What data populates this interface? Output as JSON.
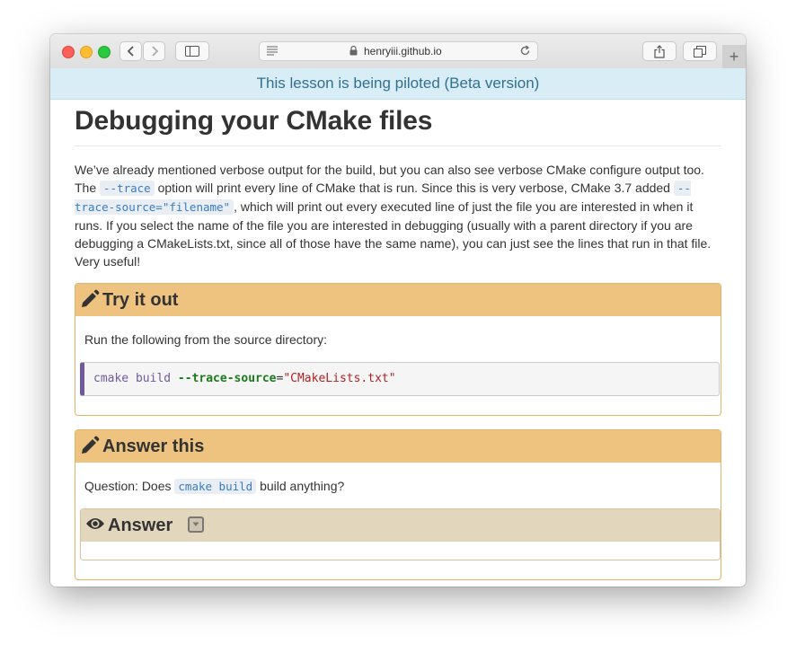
{
  "browser": {
    "url_domain": "henryiii.github.io",
    "new_tab_label": "+"
  },
  "banner": {
    "text": "This lesson is being piloted (Beta version)"
  },
  "page": {
    "title": "Debugging your CMake files",
    "intro": {
      "t1": "We’ve already mentioned verbose output for the build, but you can also see verbose CMake configure output too. The ",
      "code1": "--trace",
      "t2": " option will print every line of CMake that is run. Since this is very verbose, CMake 3.7 added ",
      "code2": "--trace-source=\"filename\"",
      "t3": ", which will print out every executed line of just the file you are interested in when it runs. If you select the name of the file you are interested in debugging (usually with a parent directory if you are debugging a CMakeLists.txt, since all of those have the same name), you can just see the lines that run in that file. Very useful!"
    }
  },
  "try_it": {
    "title": "Try it out",
    "text": "Run the following from the source directory:",
    "code": {
      "cmd": "cmake build",
      "opt": "--trace-source",
      "eq": "=",
      "str": "\"CMakeLists.txt\""
    }
  },
  "answer_this": {
    "title": "Answer this",
    "q1": "Question: Does ",
    "qcode": "cmake build",
    "q2": " build anything?",
    "answer_title": "Answer"
  },
  "colors": {
    "banner_bg": "#d9edf7",
    "banner_text": "#31708f",
    "panel_head": "#eec37f",
    "panel_border": "#e0b56b",
    "answer_head": "#e2d7bd",
    "code_accent": "#6f5a9e"
  }
}
